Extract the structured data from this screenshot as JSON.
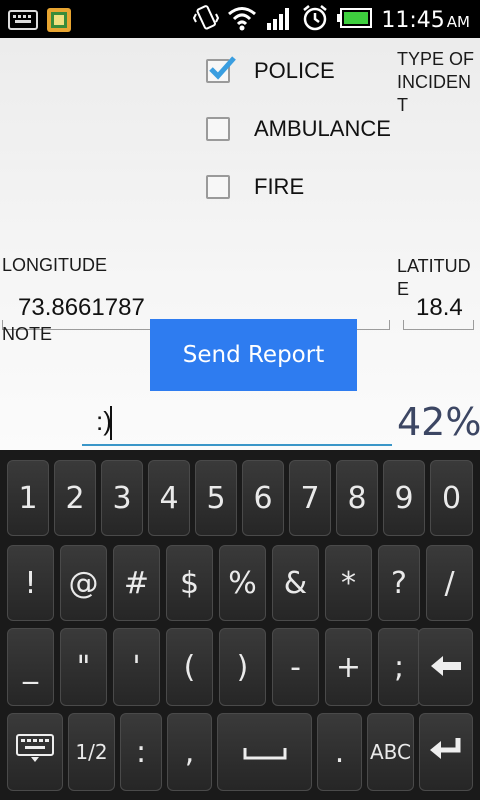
{
  "status_bar": {
    "time": "11:45",
    "ampm": "AM",
    "icons": [
      "keyboard-icon",
      "app-notification-icon",
      "vibrate-icon",
      "wifi-icon",
      "signal-icon",
      "alarm-icon",
      "battery-icon"
    ],
    "battery_color": "#3ecf3e"
  },
  "incident": {
    "type_label": "TYPE OF INCIDENT",
    "options": [
      {
        "label": "POLICE",
        "checked": true
      },
      {
        "label": "AMBULANCE",
        "checked": false
      },
      {
        "label": "FIRE",
        "checked": false
      }
    ]
  },
  "location": {
    "longitude_label": "LONGITUDE",
    "longitude_value": "73.8661787",
    "latitude_label": "LATITUDE",
    "latitude_value": "18.4"
  },
  "note": {
    "label": "NOTE",
    "value": ":)"
  },
  "send_button": {
    "label": "Send Report",
    "color": "#2e7cf0"
  },
  "battery_percent": "42%",
  "keyboard": {
    "row1": [
      "1",
      "2",
      "3",
      "4",
      "5",
      "6",
      "7",
      "8",
      "9",
      "0"
    ],
    "row2": [
      "!",
      "@",
      "#",
      "$",
      "%",
      "&",
      "*",
      "?",
      "/"
    ],
    "row3": [
      "_",
      "\"",
      "'",
      "(",
      ")",
      "-",
      "+",
      ";",
      "backspace-icon"
    ],
    "row4": [
      "keyboard-icon",
      "1/2",
      ":",
      ",",
      "space-icon",
      ".",
      "ABC",
      "enter-icon"
    ]
  }
}
